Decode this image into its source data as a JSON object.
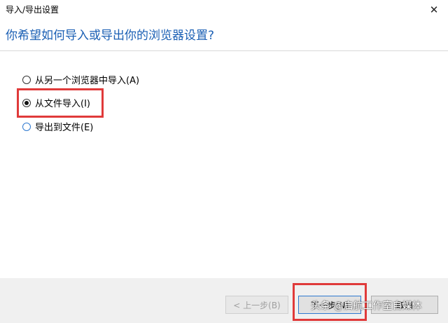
{
  "window": {
    "title": "导入/导出设置",
    "close_label": "✕"
  },
  "heading": "你希望如何导入或导出你的浏览器设置?",
  "options": [
    {
      "label": "从另一个浏览器中导入(A)",
      "checked": false
    },
    {
      "label": "从文件导入(I)",
      "checked": true
    },
    {
      "label": "导出到文件(E)",
      "checked": false
    }
  ],
  "buttons": {
    "back": "< 上一步(B)",
    "next": "下一步(N)",
    "cancel": "取消"
  },
  "watermark": "头条 @启航工作室自媒体",
  "colors": {
    "highlight": "#e03a3a",
    "heading": "#1a5fb4"
  }
}
